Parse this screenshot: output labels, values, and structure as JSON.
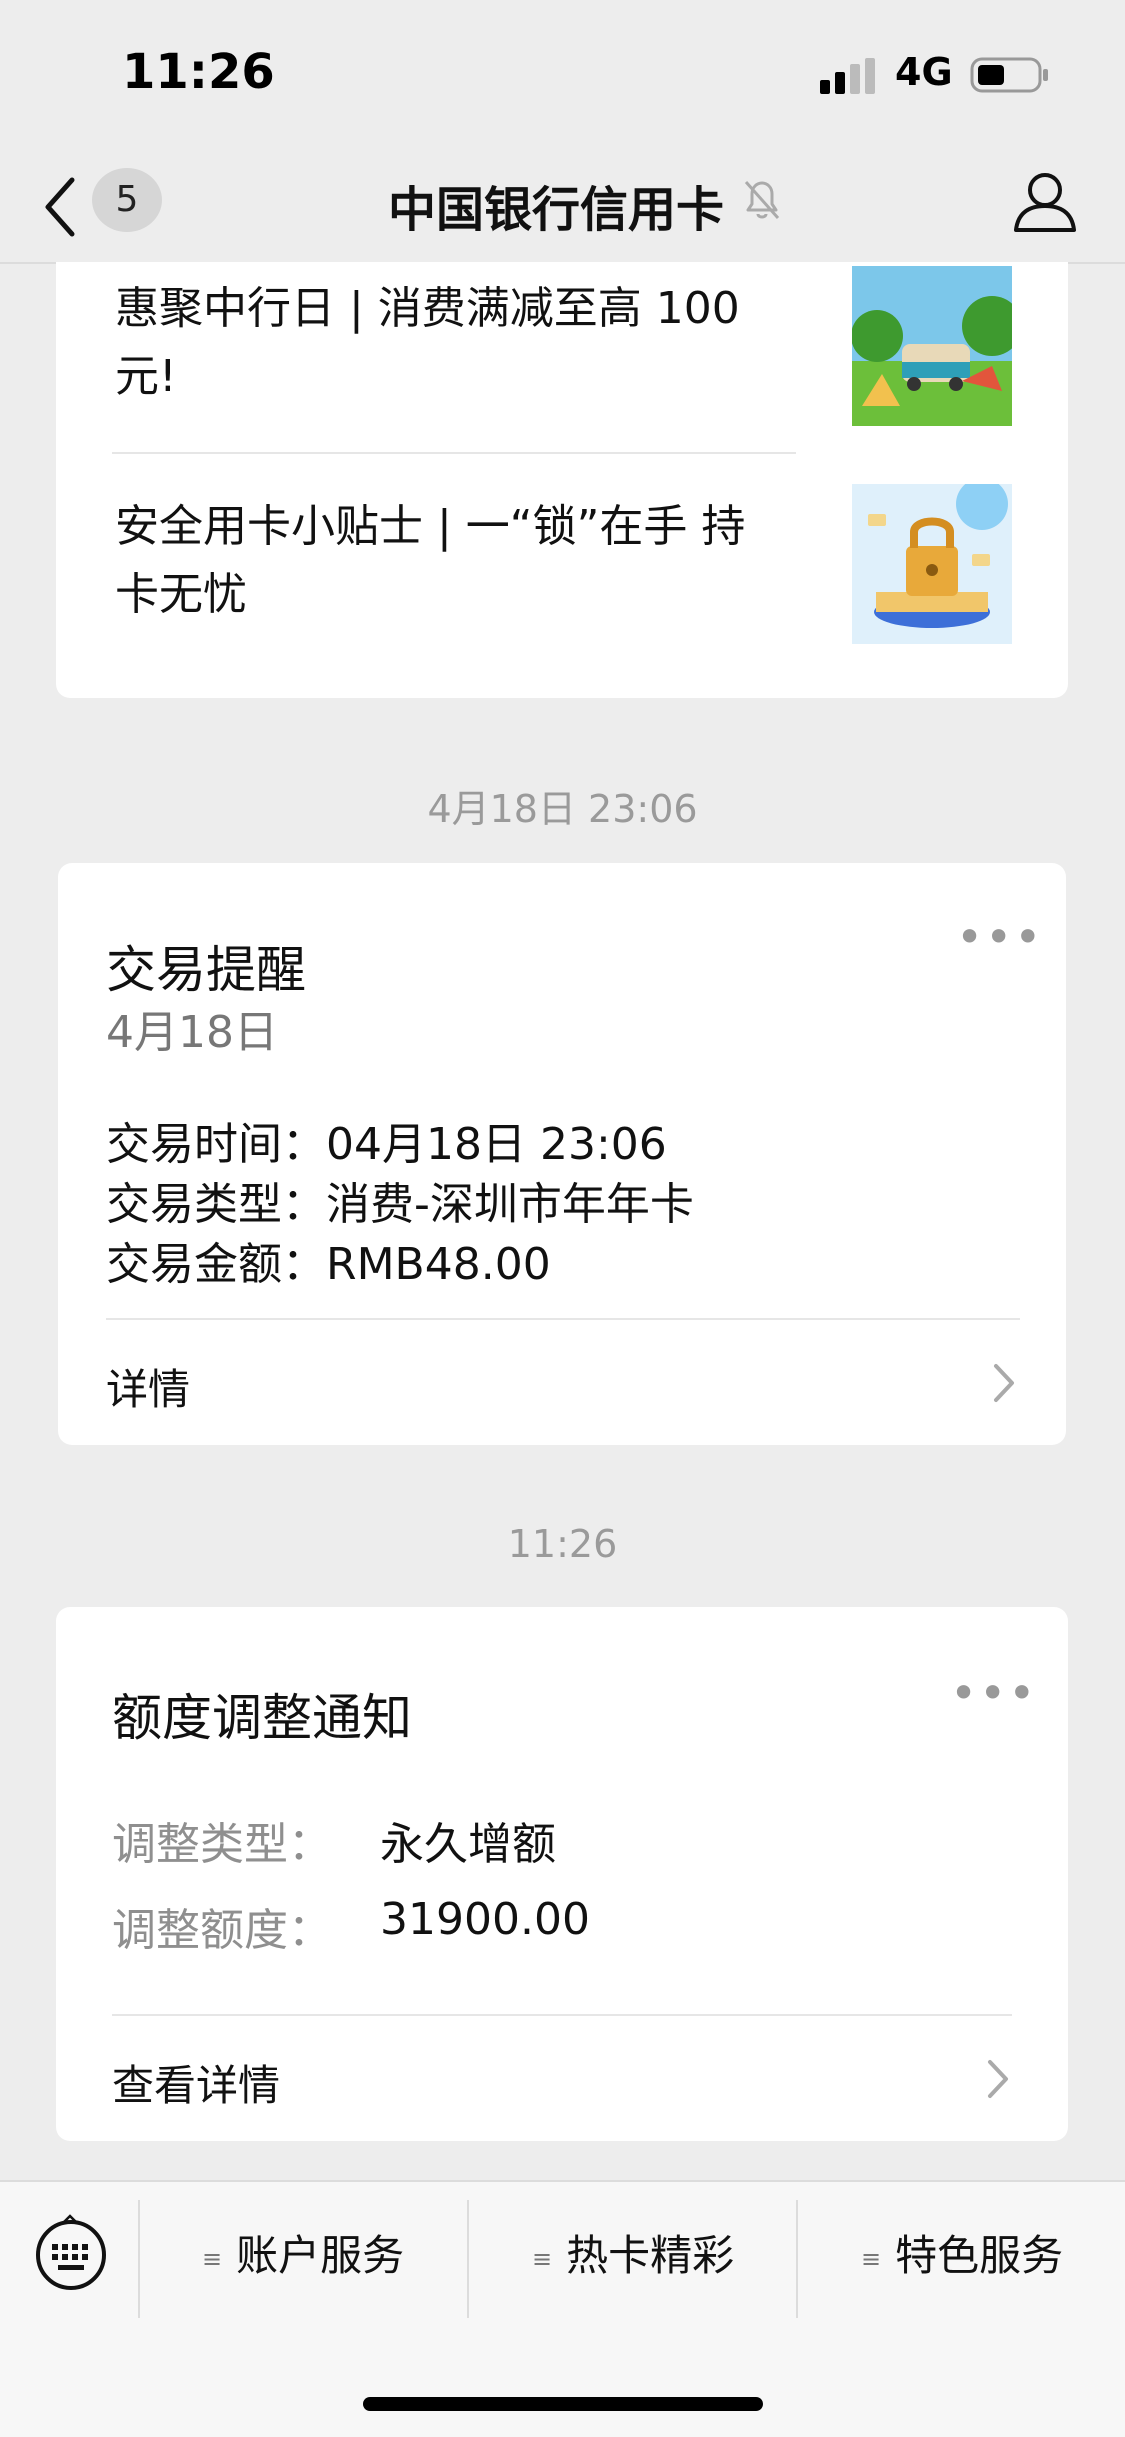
{
  "status_bar": {
    "time": "11:26",
    "network": "4G"
  },
  "header": {
    "unread_count": "5",
    "title": "中国银行信用卡"
  },
  "articles": [
    {
      "title_line1": "惠聚中行日 | 消费满减至高 100",
      "title_line2": "元!"
    },
    {
      "title_line1": "安全用卡小贴士 | 一“锁”在手 持",
      "title_line2": "卡无忧"
    }
  ],
  "messages": [
    {
      "timestamp": "4月18日 23:06",
      "title": "交易提醒",
      "subtitle": "4月18日",
      "rows": [
        "交易时间：04月18日 23:06",
        "交易类型：消费-深圳市年年卡",
        "交易金额：RMB48.00"
      ],
      "link": "详情"
    },
    {
      "timestamp": "11:26",
      "title": "额度调整通知",
      "fields": [
        {
          "label": "调整类型：",
          "value": "永久增额"
        },
        {
          "label": "调整额度：",
          "value": "31900.00"
        }
      ],
      "link": "查看详情"
    }
  ],
  "bottom_menu": {
    "tabs": [
      "账户服务",
      "热卡精彩",
      "特色服务"
    ]
  }
}
